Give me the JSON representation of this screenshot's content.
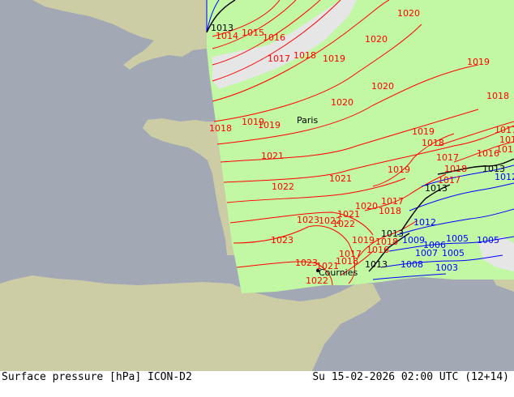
{
  "map": {
    "colors": {
      "sea": "#a2a9b4",
      "foreign_land": "#cccca5",
      "model_domain": "#c2f7a3",
      "precip_area": "#e6e6e6",
      "isobar_high": "#ff0000",
      "isobar_low": "#0000ff",
      "isobar_ref": "#000000"
    },
    "cities": [
      {
        "name": "Paris"
      },
      {
        "name": "Cournies"
      }
    ],
    "isobar_labels": [
      {
        "text": "1020"
      },
      {
        "text": "1013"
      },
      {
        "text": "1014"
      },
      {
        "text": "1015"
      },
      {
        "text": "1016"
      },
      {
        "text": "1020"
      },
      {
        "text": "1017"
      },
      {
        "text": "1018"
      },
      {
        "text": "1019"
      },
      {
        "text": "1019"
      },
      {
        "text": "1020"
      },
      {
        "text": "1018"
      },
      {
        "text": "1020"
      },
      {
        "text": "1019"
      },
      {
        "text": "1018"
      },
      {
        "text": "1017"
      },
      {
        "text": "1019"
      },
      {
        "text": "1019"
      },
      {
        "text": "1018"
      },
      {
        "text": "1017"
      },
      {
        "text": "1016"
      },
      {
        "text": "1015"
      },
      {
        "text": "1021"
      },
      {
        "text": "1019"
      },
      {
        "text": "1018"
      },
      {
        "text": "1017"
      },
      {
        "text": "1013"
      },
      {
        "text": "1013"
      },
      {
        "text": "1021"
      },
      {
        "text": "1022"
      },
      {
        "text": "1020"
      },
      {
        "text": "1017"
      },
      {
        "text": "1018"
      },
      {
        "text": "1021"
      },
      {
        "text": "1023"
      },
      {
        "text": "1022"
      },
      {
        "text": "1022"
      },
      {
        "text": "1023"
      },
      {
        "text": "1019"
      },
      {
        "text": "1013"
      },
      {
        "text": "1018"
      },
      {
        "text": "1016"
      },
      {
        "text": "1023"
      },
      {
        "text": "1021"
      },
      {
        "text": "1017"
      },
      {
        "text": "1018"
      },
      {
        "text": "1013"
      },
      {
        "text": "1022"
      },
      {
        "text": "1005"
      },
      {
        "text": "1005"
      },
      {
        "text": "1007"
      },
      {
        "text": "1005"
      },
      {
        "text": "1003"
      },
      {
        "text": "1006"
      },
      {
        "text": "1008"
      },
      {
        "text": "1009"
      },
      {
        "text": "1012"
      },
      {
        "text": "1019"
      },
      {
        "text": "1012"
      }
    ]
  },
  "footer": {
    "title": "Surface pressure [hPa] ICON-D2",
    "valid_time": "Su 15-02-2026 02:00 UTC (12+14)"
  }
}
